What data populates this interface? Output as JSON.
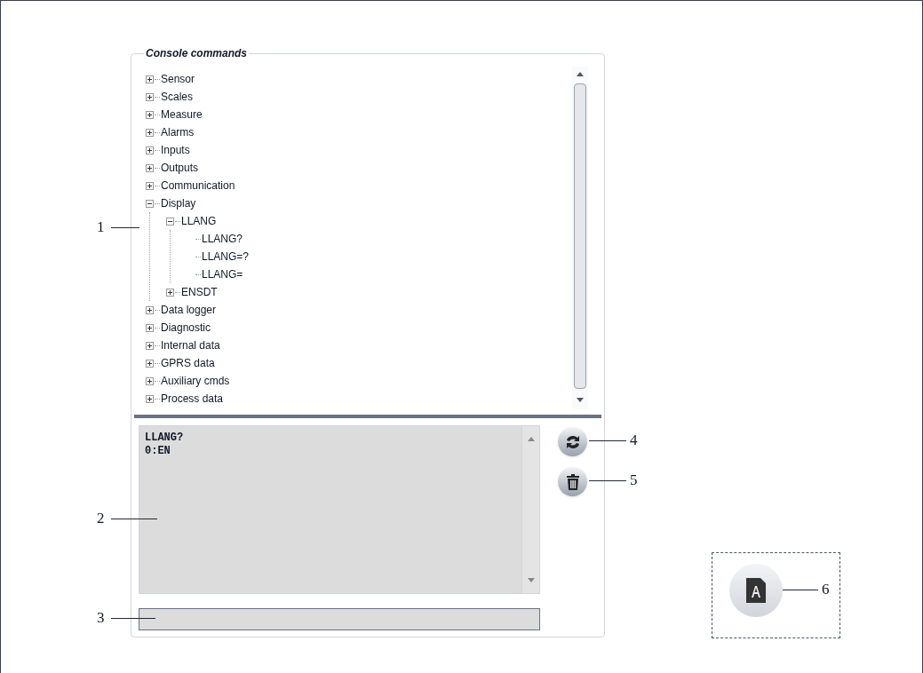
{
  "panel": {
    "title": "Console commands",
    "tree": [
      {
        "label": "Sensor",
        "expanded": false
      },
      {
        "label": "Scales",
        "expanded": false
      },
      {
        "label": "Measure",
        "expanded": false
      },
      {
        "label": "Alarms",
        "expanded": false
      },
      {
        "label": "Inputs",
        "expanded": false
      },
      {
        "label": "Outputs",
        "expanded": false
      },
      {
        "label": "Communication",
        "expanded": false
      },
      {
        "label": "Display",
        "expanded": true,
        "children": [
          {
            "label": "LLANG",
            "expanded": true,
            "children": [
              {
                "label": "LLANG?"
              },
              {
                "label": "LLANG=?"
              },
              {
                "label": "LLANG="
              }
            ]
          },
          {
            "label": "ENSDT",
            "expanded": false
          }
        ]
      },
      {
        "label": "Data logger",
        "expanded": false
      },
      {
        "label": "Diagnostic",
        "expanded": false
      },
      {
        "label": "Internal data",
        "expanded": false
      },
      {
        "label": "GPRS data",
        "expanded": false
      },
      {
        "label": "Auxiliary cmds",
        "expanded": false
      },
      {
        "label": "Process data",
        "expanded": false
      }
    ],
    "output": {
      "lines": [
        "LLANG?",
        "0:EN"
      ]
    }
  },
  "callouts": [
    {
      "label": "1"
    },
    {
      "label": "2"
    },
    {
      "label": "3"
    },
    {
      "label": "4"
    },
    {
      "label": "5"
    },
    {
      "label": "6"
    }
  ]
}
